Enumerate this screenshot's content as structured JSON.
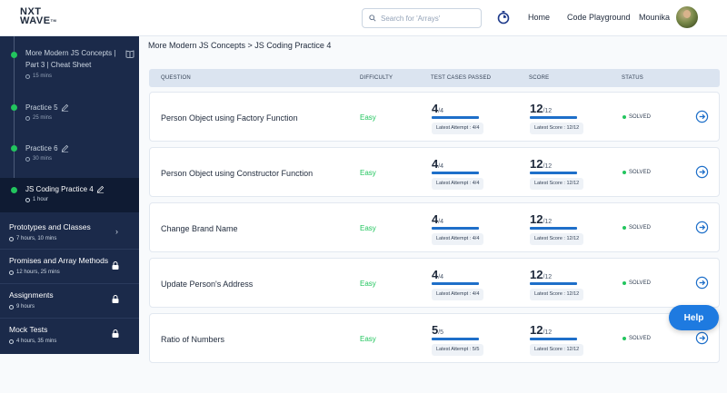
{
  "header": {
    "logo_line1": "NXT",
    "logo_line2": "WAVE",
    "logo_tm": "TM",
    "search_placeholder": "Search for 'Arrays'",
    "nav_home": "Home",
    "nav_playground": "Code Playground",
    "user_name": "Mounika"
  },
  "sidebar": {
    "sessions": [
      {
        "title_line1": "More Modern JS Concepts |",
        "title_line2": "Part 3 | Cheat Sheet",
        "duration": "15 mins",
        "icon": "book-icon"
      },
      {
        "title": "Practice 5",
        "duration": "25 mins",
        "icon": "pencil-icon"
      },
      {
        "title": "Practice 6",
        "duration": "30 mins",
        "icon": "pencil-icon"
      },
      {
        "title": "JS Coding Practice 4",
        "duration": "1 hour",
        "icon": "pencil-icon",
        "active": true
      }
    ],
    "topics": [
      {
        "title": "Prototypes and Classes",
        "duration": "7 hours, 10 mins",
        "icon": "chevron-right-icon"
      },
      {
        "title": "Promises and Array Methods",
        "duration": "12 hours, 25 mins",
        "icon": "lock-icon"
      },
      {
        "title": "Assignments",
        "duration": "9 hours",
        "icon": "lock-icon"
      },
      {
        "title": "Mock Tests",
        "duration": "4 hours, 35 mins",
        "icon": "lock-icon"
      }
    ]
  },
  "breadcrumb": "More Modern JS Concepts > JS Coding Practice 4",
  "table": {
    "headers": [
      "QUESTION",
      "DIFFICULTY",
      "TEST CASES PASSED",
      "SCORE",
      "STATUS"
    ],
    "rows": [
      {
        "question": "Person Object using Factory Function",
        "difficulty": "Easy",
        "passed": "4",
        "total": "/4",
        "attempt": "Latest Attempt : 4/4",
        "score": "12",
        "score_total": "/12",
        "latest_score": "Latest Score : 12/12",
        "status": "SOLVED"
      },
      {
        "question": "Person Object using Constructor Function",
        "difficulty": "Easy",
        "passed": "4",
        "total": "/4",
        "attempt": "Latest Attempt : 4/4",
        "score": "12",
        "score_total": "/12",
        "latest_score": "Latest Score : 12/12",
        "status": "SOLVED"
      },
      {
        "question": "Change Brand Name",
        "difficulty": "Easy",
        "passed": "4",
        "total": "/4",
        "attempt": "Latest Attempt : 4/4",
        "score": "12",
        "score_total": "/12",
        "latest_score": "Latest Score : 12/12",
        "status": "SOLVED"
      },
      {
        "question": "Update Person's Address",
        "difficulty": "Easy",
        "passed": "4",
        "total": "/4",
        "attempt": "Latest Attempt : 4/4",
        "score": "12",
        "score_total": "/12",
        "latest_score": "Latest Score : 12/12",
        "status": "SOLVED"
      },
      {
        "question": "Ratio of Numbers",
        "difficulty": "Easy",
        "passed": "5",
        "total": "/5",
        "attempt": "Latest Attempt : 5/5",
        "score": "12",
        "score_total": "/12",
        "latest_score": "Latest Score : 12/12",
        "status": "SOLVED"
      }
    ]
  },
  "help_label": "Help",
  "colors": {
    "accent": "#1e7ae0",
    "sidebar_bg": "#1b2a4a",
    "success": "#22c55e"
  }
}
